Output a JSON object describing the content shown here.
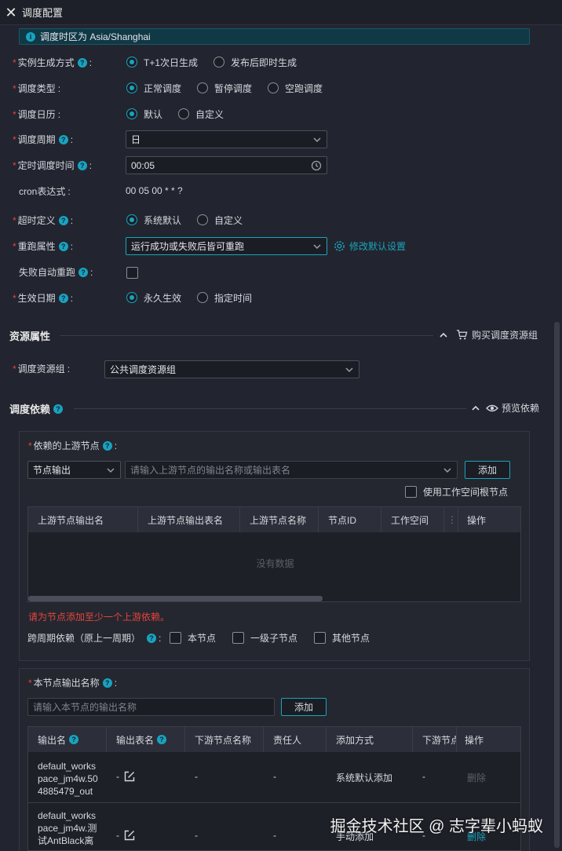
{
  "header": {
    "title": "调度配置"
  },
  "timezone_banner": "调度时区为 Asia/Shanghai",
  "form": {
    "instance_mode": {
      "label": "实例生成方式",
      "options": [
        "T+1次日生成",
        "发布后即时生成"
      ],
      "selected": 0
    },
    "schedule_type": {
      "label": "调度类型",
      "options": [
        "正常调度",
        "暂停调度",
        "空跑调度"
      ],
      "selected": 0
    },
    "calendar": {
      "label": "调度日历",
      "options": [
        "默认",
        "自定义"
      ],
      "selected": 0
    },
    "period": {
      "label": "调度周期",
      "value": "日"
    },
    "time": {
      "label": "定时调度时间",
      "value": "00:05"
    },
    "cron": {
      "label": "cron表达式",
      "value": "00 05 00 * * ?"
    },
    "timeout": {
      "label": "超时定义",
      "options": [
        "系统默认",
        "自定义"
      ],
      "selected": 0
    },
    "rerun": {
      "label": "重跑属性",
      "value": "运行成功或失败后皆可重跑",
      "link": "修改默认设置"
    },
    "auto_rerun": {
      "label": "失败自动重跑"
    },
    "effective": {
      "label": "生效日期",
      "options": [
        "永久生效",
        "指定时间"
      ],
      "selected": 0
    }
  },
  "resource": {
    "title": "资源属性",
    "action": "购买调度资源组",
    "group_label": "调度资源组",
    "group_value": "公共调度资源组"
  },
  "dependency": {
    "title": "调度依赖",
    "action": "预览依赖",
    "upstream": {
      "label": "依赖的上游节点",
      "type_select": "节点输出",
      "search_placeholder": "请输入上游节点的输出名称或输出表名",
      "add": "添加",
      "root_checkbox": "使用工作空间根节点",
      "columns": [
        "上游节点输出名",
        "上游节点输出表名",
        "上游节点名称",
        "节点ID",
        "工作空间",
        "",
        "操作"
      ],
      "empty": "没有数据",
      "error": "请为节点添加至少一个上游依赖。",
      "cross_label": "跨周期依赖（原上一周期）",
      "cross_options": [
        "本节点",
        "一级子节点",
        "其他节点"
      ]
    },
    "output": {
      "label": "本节点输出名称",
      "placeholder": "请输入本节点的输出名称",
      "add": "添加",
      "columns": [
        "输出名",
        "输出表名",
        "下游节点名称",
        "责任人",
        "添加方式",
        "下游节点",
        "操作"
      ],
      "rows": [
        {
          "name": "default_workspace_jm4w.504885479_out",
          "table": "-",
          "downstream": "-",
          "owner": "-",
          "method": "系统默认添加",
          "down2": "-",
          "op": "删除"
        },
        {
          "name": "default_workspace_jm4w.测试AntBlack离",
          "table": "-",
          "downstream": "-",
          "owner": "-",
          "method": "手动添加",
          "down2": "-",
          "op": "删除"
        }
      ]
    }
  },
  "watermark": "掘金技术社区 @ 志字辈小蚂蚁",
  "colors": {
    "accent": "#1aa3bd",
    "error": "#e5443c",
    "background": "#22252f"
  }
}
